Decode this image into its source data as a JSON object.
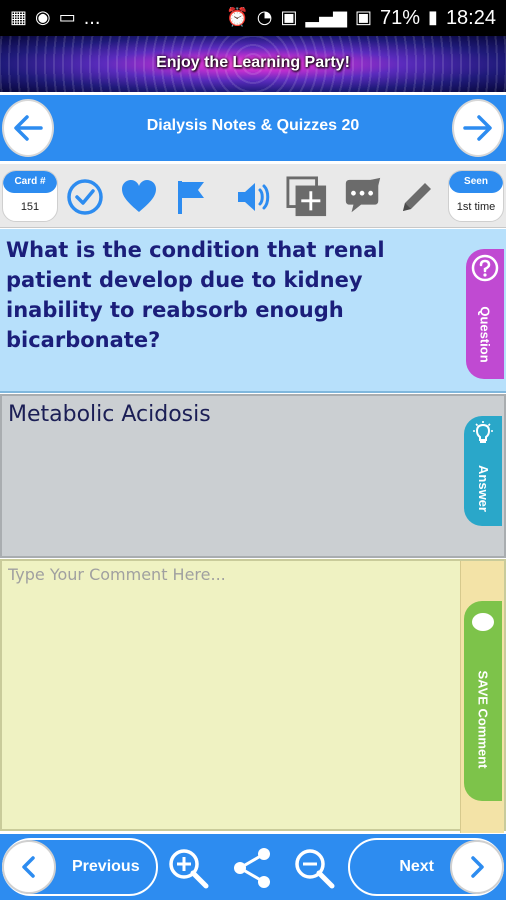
{
  "status_bar": {
    "left_icons": [
      "grid-icon",
      "whatsapp-icon",
      "message-icon"
    ],
    "left_more": "...",
    "battery": "71%",
    "time": "18:24"
  },
  "banner": {
    "text": "Enjoy the Learning Party!"
  },
  "title_bar": {
    "title": "Dialysis Notes & Quizzes 20"
  },
  "toolbar": {
    "card_label": "Card #",
    "card_value": "151",
    "seen_label": "Seen",
    "seen_value": "1st time"
  },
  "question": {
    "text": "What is the condition that renal patient develop due to kidney inability to reabsorb enough bicarbonate?",
    "tab_label": "Question"
  },
  "answer": {
    "text": "Metabolic Acidosis",
    "tab_label": "Answer"
  },
  "comment": {
    "placeholder": "Type Your Comment Here...",
    "tab_label": "SAVE Comment"
  },
  "bottom_bar": {
    "previous_label": "Previous",
    "next_label": "Next"
  },
  "colors": {
    "accent": "#2d8cf0",
    "question_bg": "#b7e0fb",
    "answer_bg": "#cbcfd2",
    "comment_bg": "#eff2c2"
  }
}
